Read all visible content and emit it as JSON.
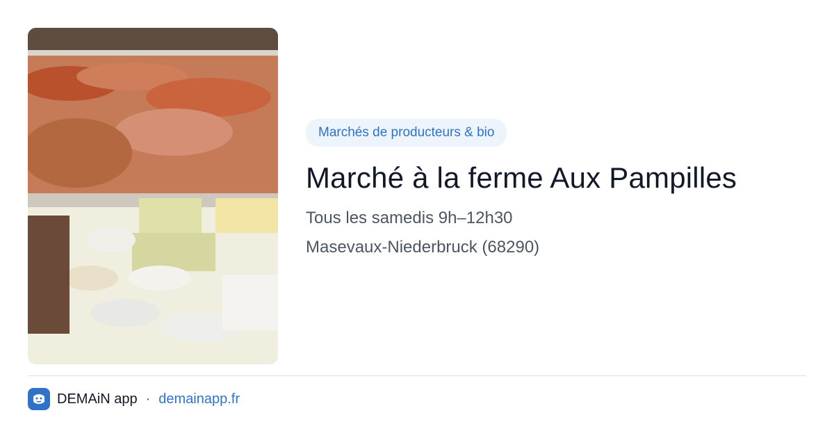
{
  "card": {
    "category": "Marchés de producteurs & bio",
    "title": "Marché à la ferme Aux Pampilles",
    "schedule": "Tous les samedis 9h–12h30",
    "location": "Masevaux-Niederbruck (68290)"
  },
  "footer": {
    "brand": "DEMAiN app",
    "separator": "·",
    "domain": "demainapp.fr"
  },
  "colors": {
    "accent": "#2f73c9",
    "tag_bg": "#eef4fb",
    "title": "#111827",
    "text": "#4b5563",
    "divider": "#dbe3ea"
  },
  "icons": {
    "app": "demain-app-icon"
  }
}
